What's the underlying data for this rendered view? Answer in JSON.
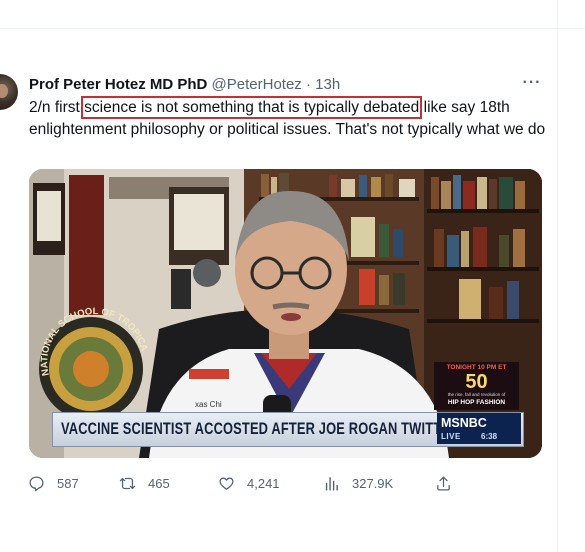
{
  "tweet": {
    "author_name": "Prof Peter Hotez MD PhD",
    "handle": "@PeterHotez",
    "separator": "·",
    "time": "13h",
    "more_label": "···",
    "text_before": "2/n first ",
    "text_highlight": "science is not something that is typically debated",
    "text_after": " like say 18th enlightenment philosophy or political issues. That's not typically what we do"
  },
  "video": {
    "headline": "VACCINE SCIENTIST ACCOSTED AFTER JOE ROGAN TWITTER TIFF",
    "promo_time": "TONIGHT 10 PM ET",
    "promo_number": "50",
    "promo_sub": "the rise, fall and revolution of",
    "promo_title": "HIP HOP FASHION",
    "network": "MSNBC",
    "live_label": "LIVE",
    "clock": "6:38",
    "emblem_text": "NATIONAL SCHOOL OF TROPICAL",
    "coat_text": "xas Chi"
  },
  "actions": {
    "replies": "587",
    "retweets": "465",
    "likes": "4,241",
    "views": "327.9K"
  },
  "icons": {
    "reply": "reply-icon",
    "retweet": "retweet-icon",
    "like": "heart-icon",
    "views": "views-icon",
    "share": "share-icon"
  },
  "colors": {
    "highlight_box": "#c62f37",
    "text": "#0f1419",
    "secondary": "#536471",
    "msnbc_blue": "#0c2350"
  }
}
